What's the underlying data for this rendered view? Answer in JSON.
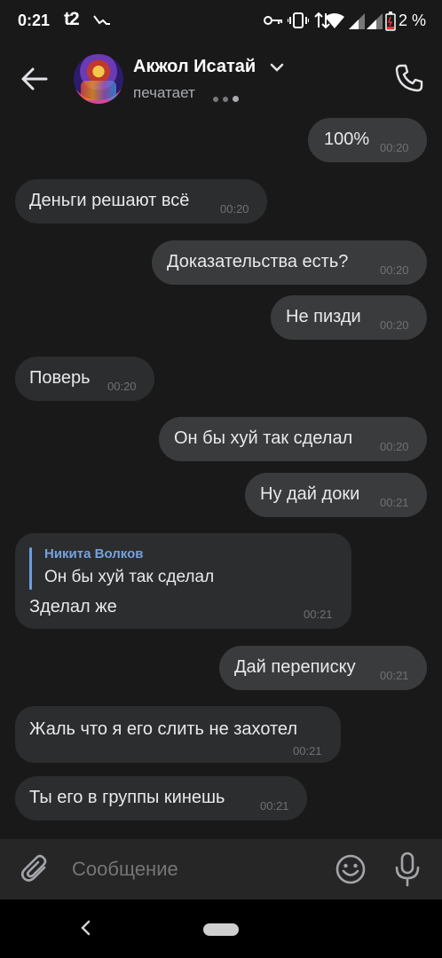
{
  "status": {
    "time": "0:21",
    "carrier": "t2",
    "battery": "2 %"
  },
  "header": {
    "name": "Акжол Исатай",
    "status": "печатает"
  },
  "messages": [
    {
      "dir": "out",
      "text": "100%",
      "time": "00:20"
    },
    {
      "dir": "in",
      "text": "Деньги решают всё",
      "time": "00:20"
    },
    {
      "dir": "out",
      "text": "Доказательства есть?",
      "time": "00:20"
    },
    {
      "dir": "out",
      "text": "Не пизди",
      "time": "00:20"
    },
    {
      "dir": "in",
      "text": "Поверь",
      "time": "00:20"
    },
    {
      "dir": "out",
      "text": "Он бы хуй так сделал",
      "time": "00:20"
    },
    {
      "dir": "out",
      "text": "Ну дай доки",
      "time": "00:21"
    },
    {
      "dir": "in",
      "text": "Зделал же",
      "time": "00:21",
      "reply": {
        "author": "Никита Волков",
        "text": "Он бы хуй так сделал"
      }
    },
    {
      "dir": "out",
      "text": "Дай переписку",
      "time": "00:21"
    },
    {
      "dir": "in",
      "text": "Жаль что я его слить не захотел",
      "time": "00:21"
    },
    {
      "dir": "in",
      "text": "Ты его в группы кинешь",
      "time": "00:21"
    }
  ],
  "composer": {
    "placeholder": "Сообщение"
  },
  "icons": {
    "back": "arrow-left-icon",
    "call": "phone-icon",
    "attach": "paperclip-icon",
    "emoji": "smile-icon",
    "voice": "microphone-icon"
  }
}
